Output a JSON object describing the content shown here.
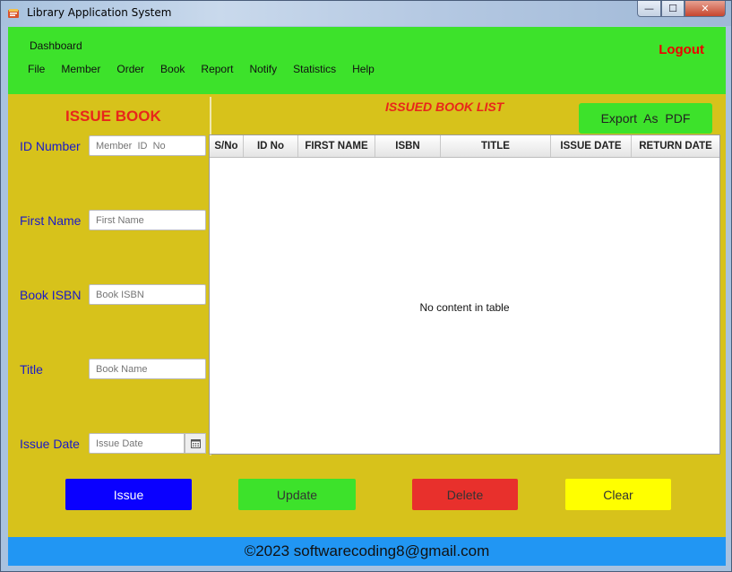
{
  "window": {
    "title": "Library Application System",
    "controls": {
      "minimize": "—",
      "maximize": "☐",
      "close": "✕"
    }
  },
  "topbar": {
    "dashboard": "Dashboard",
    "menu": [
      "File",
      "Member",
      "Order",
      "Book",
      "Report",
      "Notify",
      "Statistics",
      "Help"
    ],
    "logout": "Logout"
  },
  "issue_form": {
    "title": "ISSUE BOOK",
    "fields": {
      "id_number": {
        "label": "ID  Number",
        "placeholder": "Member  ID  No",
        "value": ""
      },
      "first_name": {
        "label": "First Name",
        "placeholder": "First Name",
        "value": ""
      },
      "book_isbn": {
        "label": "Book ISBN",
        "placeholder": "Book ISBN",
        "value": ""
      },
      "title": {
        "label": "Title",
        "placeholder": "Book Name",
        "value": ""
      },
      "issue_date": {
        "label": "Issue Date",
        "placeholder": "Issue Date",
        "value": ""
      }
    }
  },
  "issued_list": {
    "title": "ISSUED BOOK LIST",
    "export_label": "Export  As  PDF",
    "columns": [
      "S/No",
      "ID No",
      "FIRST NAME",
      "ISBN",
      "TITLE",
      "ISSUE DATE",
      "RETURN DATE"
    ],
    "rows": [],
    "empty_message": "No content in table"
  },
  "actions": {
    "issue": "Issue",
    "update": "Update",
    "delete": "Delete",
    "clear": "Clear"
  },
  "footer": {
    "text": "©2023 softwarecoding8@gmail.com"
  },
  "colors": {
    "menubar": "#3de22b",
    "background": "#d7c21b",
    "footer": "#2196f3",
    "title_red": "#e8261b",
    "label_blue": "#1a1ac8"
  }
}
